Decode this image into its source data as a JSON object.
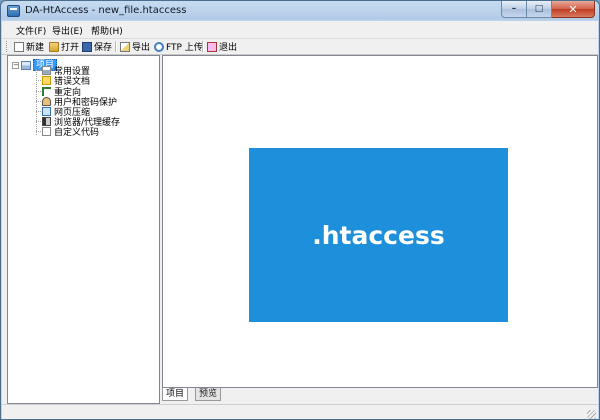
{
  "window": {
    "title": "DA-HtAccess - new_file.htaccess"
  },
  "window_buttons": {
    "minimize": "–",
    "maximize": "□",
    "close": "✕"
  },
  "menu": [
    "文件(F)",
    "导出(E)",
    "帮助(H)"
  ],
  "toolbar": {
    "new": "新建",
    "open": "打开",
    "save": "保存",
    "export": "导出",
    "ftp_upload": "FTP 上传",
    "exit": "退出"
  },
  "tree": {
    "expander": "−",
    "root": "项目",
    "children": [
      "常用设置",
      "错误文档",
      "重定向",
      "用户和密码保护",
      "网页压缩",
      "浏览器/代理缓存",
      "自定义代码"
    ]
  },
  "content": {
    "splash_text": ".htaccess",
    "splash_color": "#1e90db"
  },
  "tabs": [
    "项目",
    "预览"
  ],
  "icons": {
    "app": "app-icon",
    "new": "new-file-icon",
    "open": "open-folder-icon",
    "save": "save-disk-icon",
    "export": "export-icon",
    "ftp": "ftp-upload-icon",
    "exit": "exit-icon"
  }
}
